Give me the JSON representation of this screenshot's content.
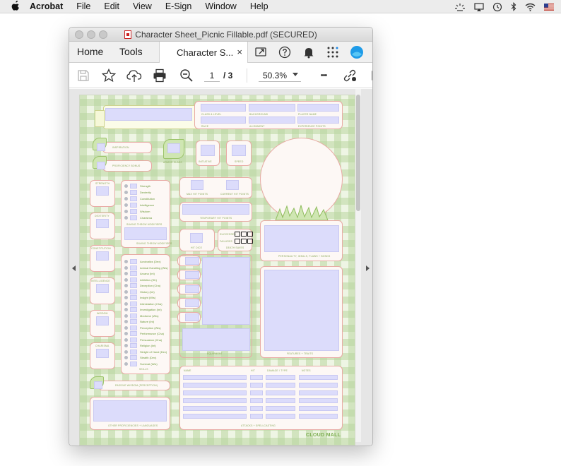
{
  "menubar": {
    "app_name": "Acrobat",
    "menus": [
      "File",
      "Edit",
      "View",
      "E-Sign",
      "Window",
      "Help"
    ]
  },
  "window": {
    "title": "Character Sheet_Picnic Fillable.pdf (SECURED)",
    "tabs": {
      "home": "Home",
      "tools": "Tools",
      "document": "Character S...",
      "close_glyph": "×"
    }
  },
  "toolbar": {
    "current_page": "1",
    "page_total": "/ 3",
    "zoom": "50.3%",
    "more_glyph": "•••"
  },
  "colors": {
    "page_bg": "#eef5e4",
    "box_border": "#e8aaa4",
    "field_fill": "#dcdcfb",
    "label_green": "#6d9a3c"
  },
  "sheet": {
    "header_labels": [
      "CLASS & LEVEL",
      "BACKGROUND",
      "PLAYER NAME",
      "RACE",
      "ALIGNMENT",
      "EXPERIENCE POINTS"
    ],
    "inspiration": "INSPIRATION",
    "proficiency_bonus": "PROFICIENCY BONUS",
    "armor_class": "ARMOR CLASS",
    "initiative": "INITIATIVE",
    "speed": "SPEED",
    "abilities": [
      "STRENGTH",
      "DEXTERITY",
      "CONSTITUTION",
      "INTELLIGENCE",
      "WISDOM",
      "CHARISMA"
    ],
    "saving_throws": [
      "Strength",
      "Dexterity",
      "Constitution",
      "Intelligence",
      "Wisdom",
      "Charisma"
    ],
    "saving_throws_caption": "SAVING THROW MODIFIERS",
    "hp_labels": [
      "MAX HIT POINTS",
      "CURRENT HIT POINTS"
    ],
    "temp_hp": "TEMPORARY HIT POINTS",
    "hit_dice": "HIT DICE",
    "death_saves": {
      "successes": "SUCCESSES",
      "failures": "FAILURES",
      "caption": "DEATH SAVES"
    },
    "personality": "PERSONALITY, IDEALS, FLAWS + BONDS",
    "skills": [
      "Acrobatics (Dex)",
      "Animal Handling (Wis)",
      "Arcana (Int)",
      "Athletics (Str)",
      "Deception (Cha)",
      "History (Int)",
      "Insight (Wis)",
      "Intimidation (Cha)",
      "Investigation (Int)",
      "Medicine (Wis)",
      "Nature (Int)",
      "Perception (Wis)",
      "Performance (Cha)",
      "Persuasion (Cha)",
      "Religion (Int)",
      "Sleight of Hand (Dex)",
      "Stealth (Dex)",
      "Survival (Wis)"
    ],
    "skills_caption": "SKILLS",
    "equipment": "EQUIPMENT",
    "features": "FEATURES + TRAITS",
    "passive_wisdom": "PASSIVE WISDOM (PERCEPTION)",
    "other_proficiencies": "OTHER PROFICIENCIES + LANGUAGES",
    "attack_headers": [
      "NAME",
      "HIT",
      "DAMAGE / TYPE",
      "NOTES"
    ],
    "attacks_caption": "ATTACKS + SPELLCASTING",
    "logo": "CLOUD MALL"
  }
}
